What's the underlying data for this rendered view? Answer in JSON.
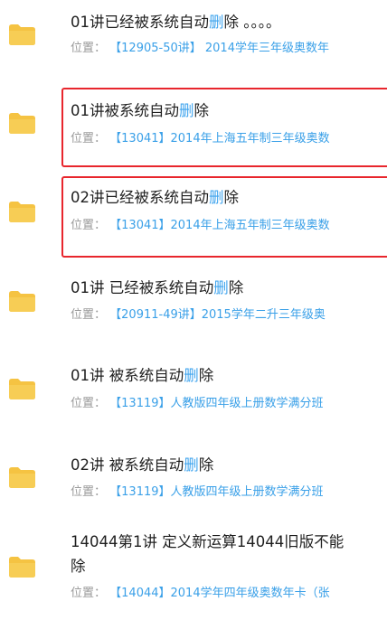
{
  "location_label": "位置：",
  "highlight_color": "#e8262d",
  "link_color": "#3aa0e8",
  "folder_color": "#f5c342",
  "items": [
    {
      "title_pre": "01讲已经被系统自动",
      "title_hl": "删",
      "title_post": "除 。。。。",
      "location": "【12905-50讲】 2014学年三年级奥数年",
      "icon": "folder-icon"
    },
    {
      "title_pre": "01讲被系统自动",
      "title_hl": "删",
      "title_post": "除",
      "location": "【13041】2014年上海五年制三年级奥数",
      "icon": "folder-icon",
      "highlighted": true
    },
    {
      "title_pre": "02讲已经被系统自动",
      "title_hl": "删",
      "title_post": "除",
      "location": "【13041】2014年上海五年制三年级奥数",
      "icon": "folder-icon",
      "highlighted": true
    },
    {
      "title_pre": "01讲 已经被系统自动",
      "title_hl": "删",
      "title_post": "除",
      "location": "【20911-49讲】2015学年二升三年级奥",
      "icon": "folder-icon"
    },
    {
      "title_pre": "01讲 被系统自动",
      "title_hl": "删",
      "title_post": "除",
      "location": "【13119】人教版四年级上册数学满分班",
      "icon": "folder-icon"
    },
    {
      "title_pre": "02讲 被系统自动",
      "title_hl": "删",
      "title_post": "除",
      "location": "【13119】人教版四年级上册数学满分班",
      "icon": "folder-icon"
    },
    {
      "title_line1": "14044第1讲 定义新运算14044旧版不能",
      "title_line2": "除",
      "location": "【14044】2014学年四年级奥数年卡（张",
      "icon": "folder-icon"
    }
  ]
}
